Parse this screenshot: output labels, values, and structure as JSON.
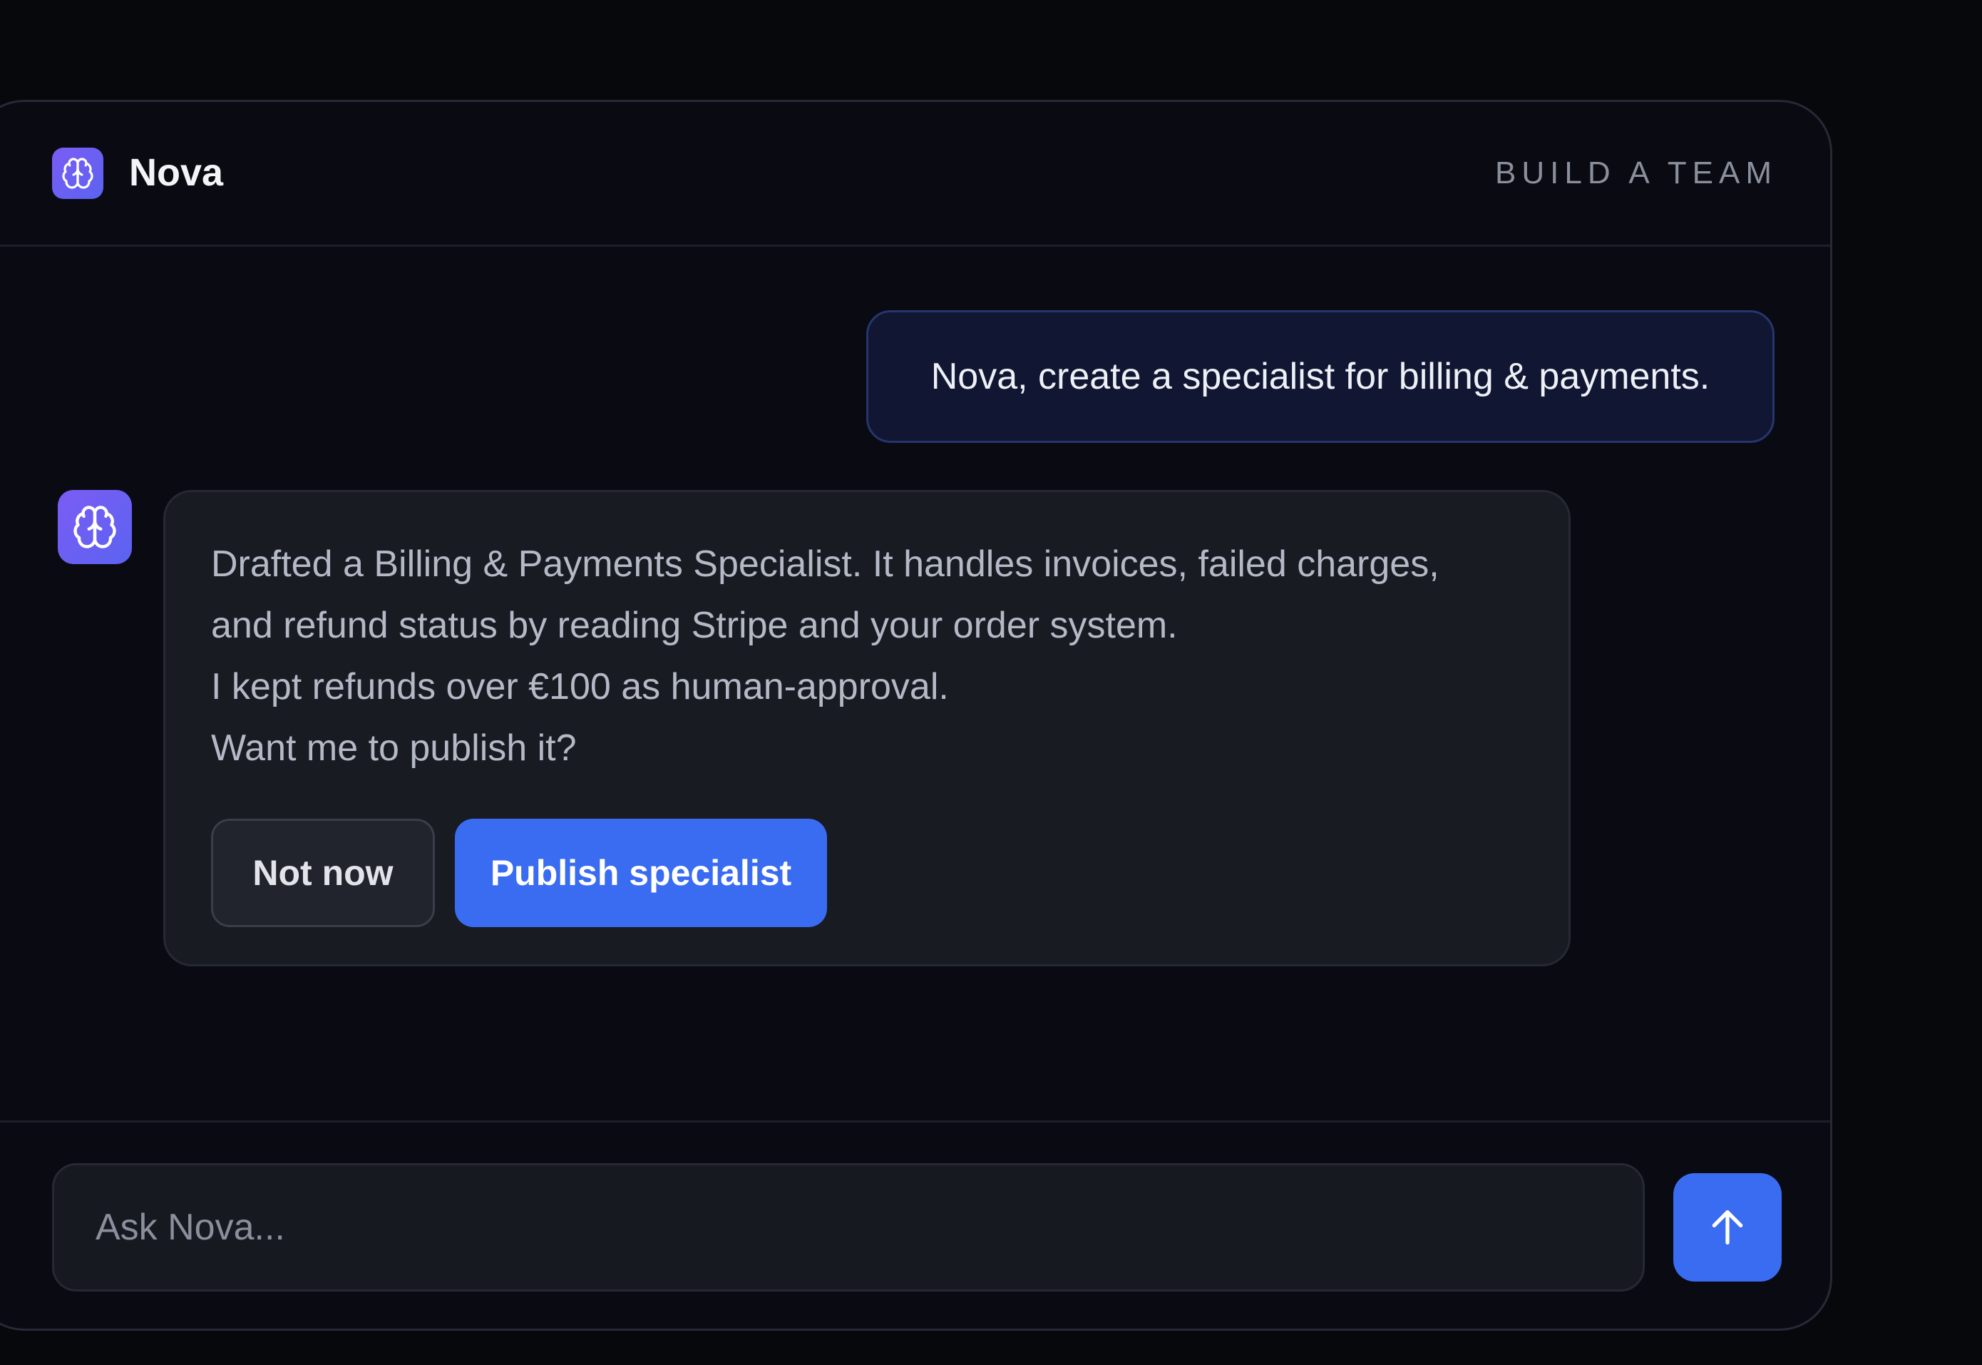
{
  "app": {
    "name": "Nova",
    "header_action": "BUILD A TEAM"
  },
  "conversation": {
    "user_message": "Nova, create a specialist for billing & payments.",
    "assistant_message": {
      "lines": [
        "Drafted a Billing & Payments Specialist. It handles invoices, failed charges,",
        "and refund status by reading Stripe and your order system.",
        "I kept refunds over €100 as human-approval.",
        "Want me to publish it?"
      ],
      "secondary_action": "Not now",
      "primary_action": "Publish specialist"
    }
  },
  "composer": {
    "placeholder": "Ask Nova..."
  },
  "icons": {
    "brand": "brain-icon",
    "assistant_avatar": "brain-icon",
    "send": "arrow-up-icon"
  },
  "colors": {
    "accent": "#3a6cf2",
    "brand_gradient_start": "#7b5cf5",
    "brand_gradient_end": "#5b63f0"
  }
}
